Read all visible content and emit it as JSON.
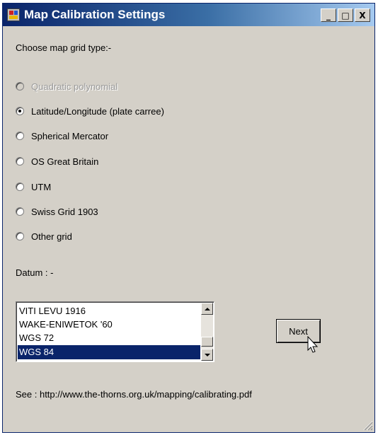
{
  "window": {
    "title": "Map Calibration Settings",
    "min_glyph": "_",
    "max_glyph": "□",
    "close_glyph": "X"
  },
  "grid_type_label": "Choose map grid type:-",
  "grid_options": [
    {
      "label": "Quadratic polynomial",
      "checked": false,
      "disabled": true
    },
    {
      "label": "Latitude/Longitude (plate carree)",
      "checked": true,
      "disabled": false
    },
    {
      "label": "Spherical Mercator",
      "checked": false,
      "disabled": false
    },
    {
      "label": "OS Great Britain",
      "checked": false,
      "disabled": false
    },
    {
      "label": "UTM",
      "checked": false,
      "disabled": false
    },
    {
      "label": "Swiss Grid 1903",
      "checked": false,
      "disabled": false
    },
    {
      "label": "Other grid",
      "checked": false,
      "disabled": false
    }
  ],
  "datum_label": "Datum : -",
  "datum_list": {
    "items": [
      "VITI LEVU 1916",
      "WAKE-ENIWETOK '60",
      "WGS 72",
      "WGS 84"
    ],
    "selected": "WGS 84"
  },
  "next_button": "Next",
  "see_text": "See : http://www.the-thorns.org.uk/mapping/calibrating.pdf",
  "colors": {
    "title_gradient_start": "#0a246a",
    "title_gradient_end": "#a6caf0",
    "window_bg": "#d4d0c8",
    "selection_bg": "#0a246a"
  }
}
